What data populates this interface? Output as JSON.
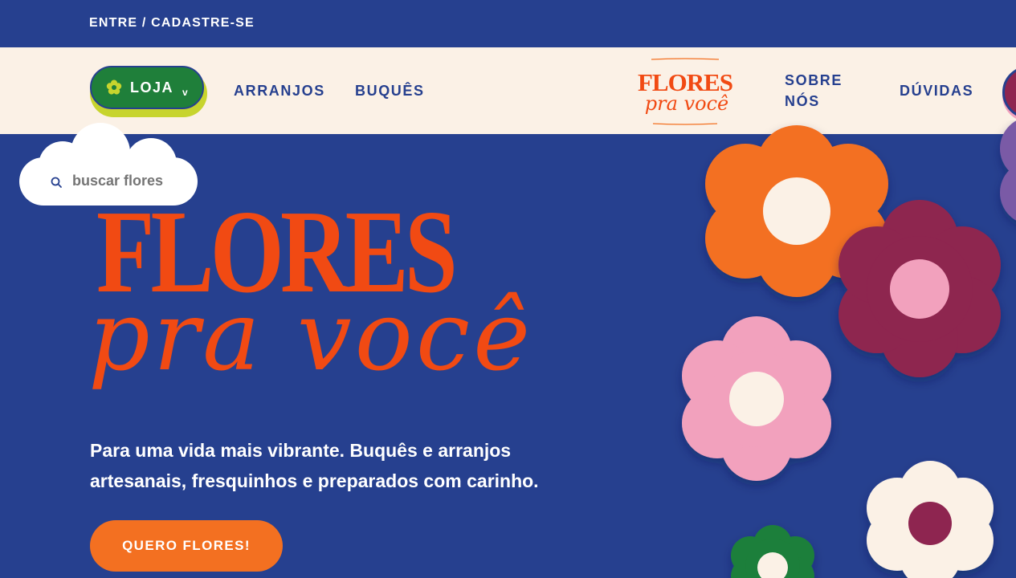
{
  "topbar": {
    "login_link": "ENTRE / CADASTRE-SE"
  },
  "nav": {
    "shop_button": "LOJA",
    "shop_chevron": "v",
    "links": [
      "ARRANJOS",
      "BUQUÊS",
      "SOBRE",
      "NÓS",
      "DÚVIDAS"
    ]
  },
  "logo": {
    "line1": "FLORES",
    "line2": "pra você"
  },
  "search": {
    "placeholder": "buscar flores"
  },
  "hero": {
    "title": "FLORES",
    "script": "pra você",
    "description_line1": "Para uma vida mais vibrante. Buquês e arranjos",
    "description_line2": "artesanais, fresquinhos e preparados com carinho.",
    "cta": "QUERO FLORES!"
  },
  "colors": {
    "navy": "#26408f",
    "cream": "#fbf1e6",
    "orange": "#f37021",
    "red_orange": "#f14a13",
    "green": "#1f7f3a",
    "lime": "#c7d42e",
    "pink": "#f2a1bd",
    "plum": "#8e2550",
    "purple": "#7a5aa6"
  }
}
